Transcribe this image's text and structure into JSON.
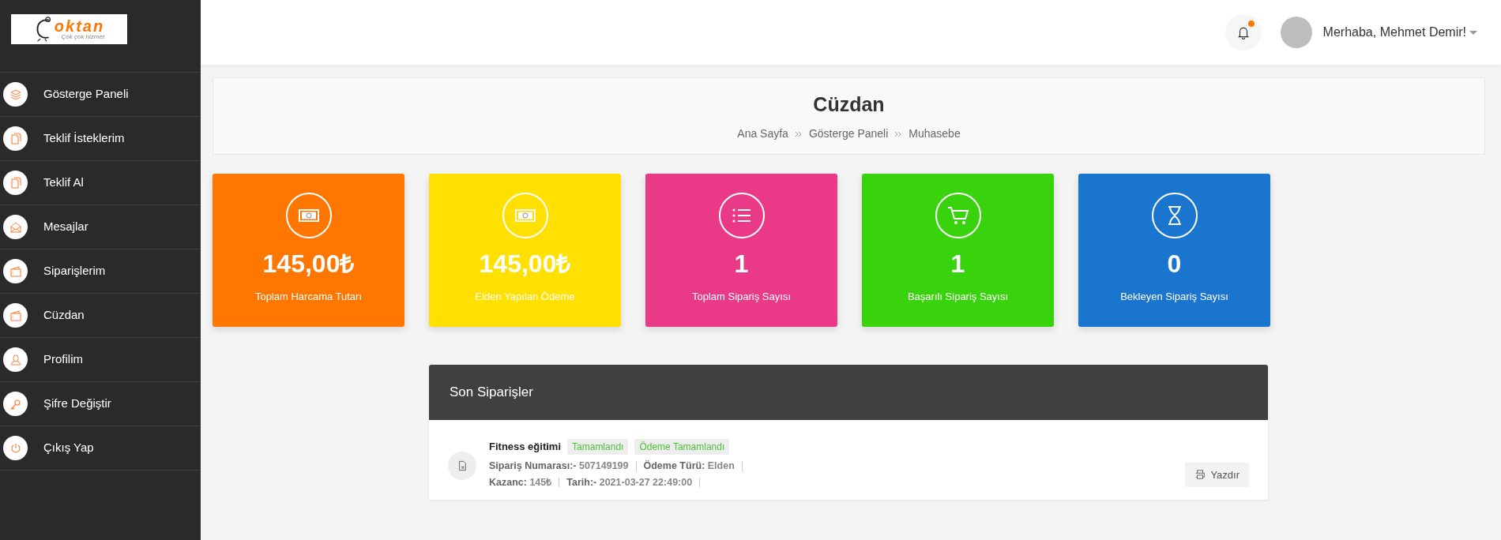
{
  "logo": {
    "brand": "oktan",
    "tagline": "Çok çok hizmet"
  },
  "sidebar": {
    "items": [
      {
        "label": "Gösterge Paneli",
        "kind": "layers"
      },
      {
        "label": "Teklif İsteklerim",
        "kind": "copy"
      },
      {
        "label": "Teklif Al",
        "kind": "copy"
      },
      {
        "label": "Mesajlar",
        "kind": "mail"
      },
      {
        "label": "Siparişlerim",
        "kind": "wallet"
      },
      {
        "label": "Cüzdan",
        "kind": "wallet"
      },
      {
        "label": "Profilim",
        "kind": "user"
      },
      {
        "label": "Şifre Değiştir",
        "kind": "key"
      },
      {
        "label": "Çıkış Yap",
        "kind": "power"
      }
    ]
  },
  "header": {
    "notifications": {
      "unread": true
    },
    "user": {
      "greeting": "Merhaba, Mehmet Demir!"
    }
  },
  "page": {
    "title": "Cüzdan",
    "breadcrumb": [
      "Ana Sayfa",
      "Gösterge Paneli",
      "Muhasebe"
    ]
  },
  "stats": [
    {
      "value": "145,00₺",
      "label": "Toplam Harcama Tutarı",
      "color": "#ff7600",
      "kind": "money"
    },
    {
      "value": "145,00₺",
      "label": "Elden Yapılan Ödeme",
      "color": "#ffe000",
      "kind": "money"
    },
    {
      "value": "1",
      "label": "Toplam Sipariş Sayısı",
      "color": "#ea3a87",
      "kind": "list"
    },
    {
      "value": "1",
      "label": "Başarılı Sipariş Sayısı",
      "color": "#38d30d",
      "kind": "cart"
    },
    {
      "value": "0",
      "label": "Bekleyen Sipariş Sayısı",
      "color": "#1a75cf",
      "kind": "hourglass"
    }
  ],
  "recent_orders": {
    "title": "Son Siparişler",
    "orders": [
      {
        "title": "Fitness eğitimi",
        "badges": [
          "Tamamlandı",
          "Ödeme Tamamlandı"
        ],
        "lines": [
          [
            {
              "label": "Sipariş Numarası:-",
              "value": "507149199"
            },
            {
              "label": "Ödeme Türü:",
              "value": "Elden"
            }
          ],
          [
            {
              "label": "Kazanc:",
              "value": "145₺"
            },
            {
              "label": "Tarih:-",
              "value": "2021-03-27 22:49:00"
            }
          ]
        ],
        "print_button": "Yazdır"
      }
    ]
  }
}
